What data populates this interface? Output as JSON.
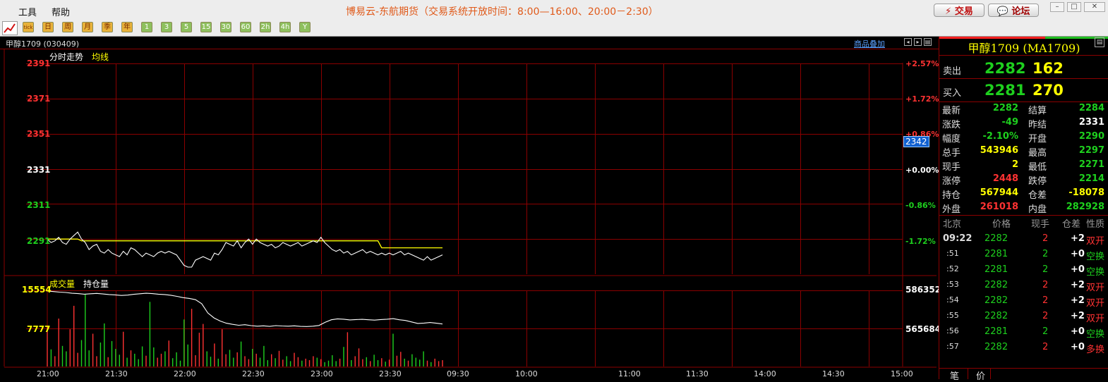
{
  "menu": {
    "tools": "工具",
    "help": "帮助"
  },
  "app_title": "博易云-东航期货（交易系统开放时间：8:00—16:00、20:00－2:30）",
  "top_buttons": {
    "trade": "⚡ 交易",
    "forum": "💬 论坛"
  },
  "toolbar": [
    "tick",
    "日",
    "周",
    "月",
    "季",
    "年",
    "1",
    "3",
    "5",
    "15",
    "30",
    "60",
    "2h",
    "4h",
    "Y"
  ],
  "chart": {
    "symbol_code": "甲醇1709 (030409)",
    "overlay_link": "商品叠加",
    "legend_price": "分时走势",
    "legend_avg": "均线",
    "legend_volume": "成交量",
    "legend_oi": "持仓量",
    "price_ticks": [
      "2391",
      "2371",
      "2351",
      "2331",
      "2311",
      "2291"
    ],
    "pct_ticks": [
      "+2.57%",
      "+1.72%",
      "+0.86%",
      "+0.00%",
      "-0.86%",
      "-1.72%"
    ],
    "cursor_price": "2342",
    "vol_ticks": [
      "15554",
      "7777"
    ],
    "oi_ticks": [
      "586352",
      "565684"
    ],
    "time_ticks": [
      "21:00",
      "21:30",
      "22:00",
      "22:30",
      "23:00",
      "23:30",
      "09:30",
      "10:00",
      "11:00",
      "11:30",
      "14:00",
      "14:30",
      "15:00"
    ],
    "colors": {
      "up": "#ff3232",
      "down": "#1ed01e",
      "avg": "#ffff00",
      "grid": "#8b0000"
    }
  },
  "chart_data": {
    "type": "line",
    "title": "分时走势",
    "ylim": [
      2271,
      2391
    ],
    "prev_settle": 2331,
    "price": [
      2291,
      2289,
      2290,
      2292,
      2289,
      2288,
      2291,
      2293,
      2295,
      2291,
      2289,
      2285,
      2287,
      2288,
      2284,
      2283,
      2285,
      2283,
      2282,
      2281,
      2284,
      2282,
      2286,
      2285,
      2283,
      2281,
      2283,
      2282,
      2281,
      2283,
      2284,
      2283,
      2284,
      2283,
      2282,
      2279,
      2276,
      2275,
      2275,
      2279,
      2280,
      2281,
      2280,
      2279,
      2283,
      2282,
      2285,
      2289,
      2288,
      2287,
      2290,
      2286,
      2289,
      2291,
      2288,
      2291,
      2289,
      2288,
      2287,
      2288,
      2286,
      2287,
      2289,
      2288,
      2287,
      2288,
      2289,
      2287,
      2288,
      2289,
      2290,
      2289,
      2292,
      2289,
      2287,
      2285,
      2284,
      2285,
      2283,
      2284,
      2282,
      2283,
      2284,
      2285,
      2283,
      2284,
      2283,
      2282,
      2283,
      2282,
      2283,
      2282,
      2283,
      2284,
      2282,
      2283,
      2282,
      2281,
      2280,
      2279,
      2281,
      2279,
      2280,
      2281,
      2282
    ],
    "avg": [
      2291,
      2291,
      2291,
      2291,
      2291,
      2291,
      2291,
      2291,
      2291,
      2290,
      2290,
      2290,
      2290,
      2290,
      2290,
      2290,
      2290,
      2290,
      2290,
      2290,
      2290,
      2290,
      2290,
      2290,
      2290,
      2290,
      2290,
      2290,
      2290,
      2290,
      2290,
      2290,
      2290,
      2290,
      2290,
      2290,
      2290,
      2290,
      2290,
      2290,
      2290,
      2290,
      2290,
      2290,
      2290,
      2290,
      2290,
      2290,
      2290,
      2290,
      2290,
      2290,
      2290,
      2290,
      2290,
      2290,
      2290,
      2290,
      2290,
      2290,
      2290,
      2290,
      2290,
      2290,
      2290,
      2290,
      2290,
      2290,
      2290,
      2290,
      2290,
      2290,
      2290,
      2290,
      2290,
      2290,
      2290,
      2290,
      2290,
      2290,
      2290,
      2290,
      2290,
      2290,
      2290,
      2290,
      2290,
      2290,
      2286,
      2286,
      2286,
      2286,
      2286,
      2286,
      2286,
      2286,
      2286,
      2286,
      2286,
      2286,
      2286,
      2286,
      2286,
      2286,
      2286
    ],
    "volume_max": 15554,
    "volume": [
      8200,
      3500,
      2100,
      9800,
      4200,
      3100,
      7600,
      12400,
      2800,
      5400,
      14800,
      3300,
      6700,
      2100,
      4900,
      8800,
      1900,
      5200,
      3600,
      2400,
      7100,
      1800,
      3300,
      2600,
      1500,
      4100,
      2200,
      13200,
      3900,
      1800,
      2600,
      3100,
      5300,
      1700,
      2900,
      1200,
      9600,
      4500,
      11800,
      2300,
      6900,
      8700,
      3100,
      2000,
      4700,
      1600,
      7600,
      2500,
      3400,
      1800,
      2900,
      5100,
      2100,
      1500,
      3600,
      2600,
      1800,
      4200,
      1300,
      2500,
      1700,
      3200,
      1400,
      2100,
      1100,
      2800,
      1900,
      1200,
      1600,
      1300,
      2100,
      1800,
      1500,
      900,
      1200,
      2300,
      1100,
      1600,
      4000,
      7000,
      1300,
      2100,
      3700,
      1500,
      1900,
      1100,
      2400,
      1300,
      1700,
      1000,
      1400,
      6700,
      2200,
      3000,
      1600,
      1200,
      2500,
      1800,
      1400,
      3100,
      1200,
      900,
      1600,
      1100,
      1300
    ],
    "open_interest": [
      586000,
      585700,
      585400,
      585200,
      584800,
      584600,
      584300,
      584500,
      584700,
      584400,
      584100,
      583900,
      583600,
      583800,
      584200,
      584500,
      584800,
      584600,
      584300,
      584100,
      583700,
      583100,
      582400,
      582000,
      581300,
      579100,
      574100,
      571400,
      569700,
      568500,
      567900,
      567400,
      567700,
      567200,
      566900,
      567100,
      566800,
      567200,
      567000,
      566900,
      567100,
      566800,
      566700,
      566900,
      567300,
      569000,
      570400,
      570900,
      570700,
      570300,
      570500,
      570600,
      570400,
      570200,
      570500,
      570700,
      571000,
      570400,
      570000,
      569200,
      568400,
      568600,
      568900,
      568500,
      568100
    ],
    "oi_ylim": [
      545000,
      586352
    ],
    "xlabel": "",
    "ylabel": ""
  },
  "panel": {
    "title": "甲醇1709 (MA1709)",
    "sell_label": "卖出",
    "sell_price": "2282",
    "sell_qty": "162",
    "buy_label": "买入",
    "buy_price": "2281",
    "buy_qty": "270",
    "stats": [
      {
        "l1": "最新",
        "v1": "2282",
        "c1": "#1ed01e",
        "l2": "结算",
        "v2": "2284",
        "c2": "#1ed01e"
      },
      {
        "l1": "涨跌",
        "v1": "-49",
        "c1": "#1ed01e",
        "l2": "昨结",
        "v2": "2331",
        "c2": "#ffffff"
      },
      {
        "l1": "幅度",
        "v1": "-2.10%",
        "c1": "#1ed01e",
        "l2": "开盘",
        "v2": "2290",
        "c2": "#1ed01e"
      },
      {
        "l1": "总手",
        "v1": "543946",
        "c1": "#ffff00",
        "l2": "最高",
        "v2": "2297",
        "c2": "#1ed01e"
      },
      {
        "l1": "现手",
        "v1": "2",
        "c1": "#ffff00",
        "l2": "最低",
        "v2": "2271",
        "c2": "#1ed01e"
      },
      {
        "l1": "涨停",
        "v1": "2448",
        "c1": "#ff3232",
        "l2": "跌停",
        "v2": "2214",
        "c2": "#1ed01e"
      },
      {
        "l1": "持仓",
        "v1": "567944",
        "c1": "#ffff00",
        "l2": "仓差",
        "v2": "-18078",
        "c2": "#ffff00"
      },
      {
        "l1": "外盘",
        "v1": "261018",
        "c1": "#ff3232",
        "l2": "内盘",
        "v2": "282928",
        "c2": "#1ed01e"
      }
    ],
    "tick_headers": [
      "北京",
      "价格",
      "现手",
      "仓差",
      "性质"
    ],
    "ticks": [
      {
        "time": "09:22",
        "price": "2282",
        "qty": "2",
        "oi": "+2",
        "nature": "双开",
        "pc": "#1ed01e",
        "qc": "#ff3232",
        "nc": "#ff3232"
      },
      {
        "time": ":51",
        "price": "2281",
        "qty": "2",
        "oi": "+0",
        "nature": "空换",
        "pc": "#1ed01e",
        "qc": "#1ed01e",
        "nc": "#1ed01e"
      },
      {
        "time": ":52",
        "price": "2281",
        "qty": "2",
        "oi": "+0",
        "nature": "空换",
        "pc": "#1ed01e",
        "qc": "#1ed01e",
        "nc": "#1ed01e"
      },
      {
        "time": ":53",
        "price": "2282",
        "qty": "2",
        "oi": "+2",
        "nature": "双开",
        "pc": "#1ed01e",
        "qc": "#ff3232",
        "nc": "#ff3232"
      },
      {
        "time": ":54",
        "price": "2282",
        "qty": "2",
        "oi": "+2",
        "nature": "双开",
        "pc": "#1ed01e",
        "qc": "#ff3232",
        "nc": "#ff3232"
      },
      {
        "time": ":55",
        "price": "2282",
        "qty": "2",
        "oi": "+2",
        "nature": "双开",
        "pc": "#1ed01e",
        "qc": "#ff3232",
        "nc": "#ff3232"
      },
      {
        "time": ":56",
        "price": "2281",
        "qty": "2",
        "oi": "+0",
        "nature": "空换",
        "pc": "#1ed01e",
        "qc": "#1ed01e",
        "nc": "#1ed01e"
      },
      {
        "time": ":57",
        "price": "2282",
        "qty": "2",
        "oi": "+0",
        "nature": "多换",
        "pc": "#1ed01e",
        "qc": "#ff3232",
        "nc": "#ff3232"
      }
    ],
    "bottom_tabs": [
      "笔",
      "价"
    ]
  }
}
